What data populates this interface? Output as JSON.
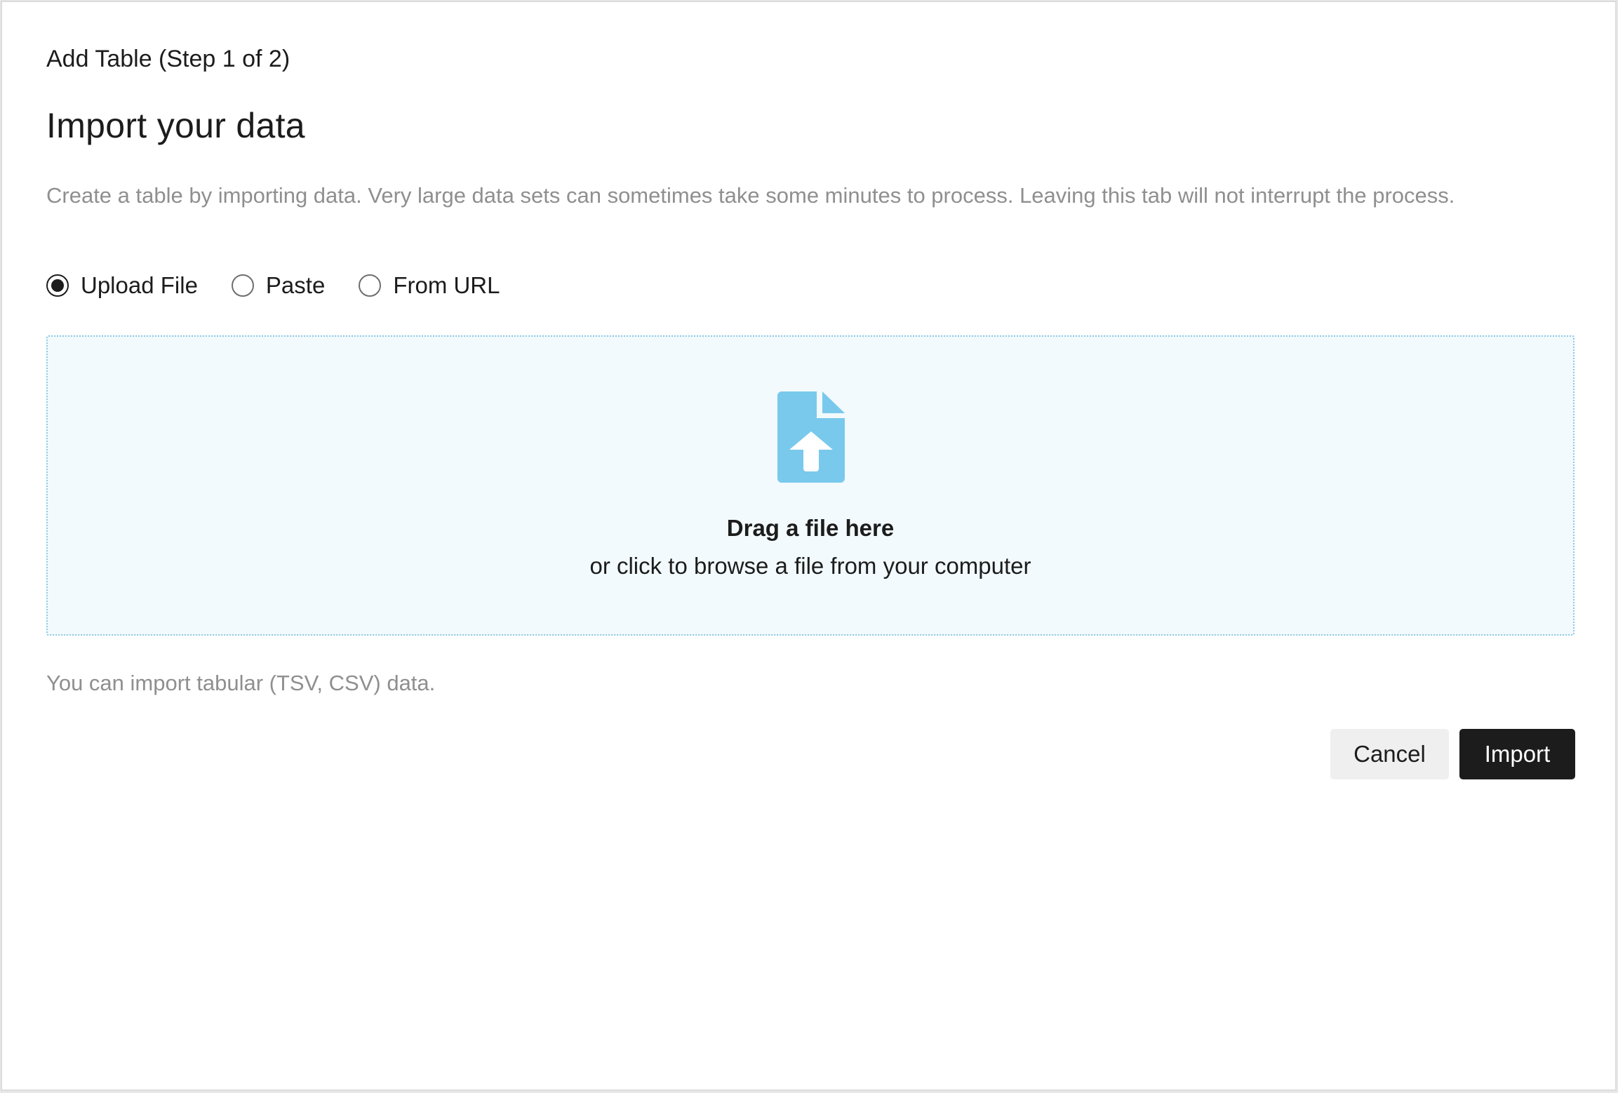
{
  "dialog": {
    "step_title": "Add Table (Step 1 of 2)",
    "title": "Import your data",
    "description": "Create a table by importing data. Very large data sets can sometimes take some minutes to process. Leaving this tab will not interrupt the process."
  },
  "source_options": {
    "selected": "Upload File",
    "items": [
      {
        "label": "Upload File",
        "checked": true
      },
      {
        "label": "Paste",
        "checked": false
      },
      {
        "label": "From URL",
        "checked": false
      }
    ]
  },
  "dropzone": {
    "icon": "file-upload-icon",
    "icon_color": "#79c9ec",
    "title": "Drag a file here",
    "subtitle": "or click to browse a file from your computer"
  },
  "hint": "You can import tabular (TSV, CSV) data.",
  "actions": {
    "cancel_label": "Cancel",
    "import_label": "Import"
  },
  "colors": {
    "primary_button": "#1c1c1c",
    "secondary_button": "#efefef",
    "dropzone_background": "#f2fafd",
    "dropzone_border": "#8cc8e2",
    "muted_text": "#8f8f8f"
  }
}
